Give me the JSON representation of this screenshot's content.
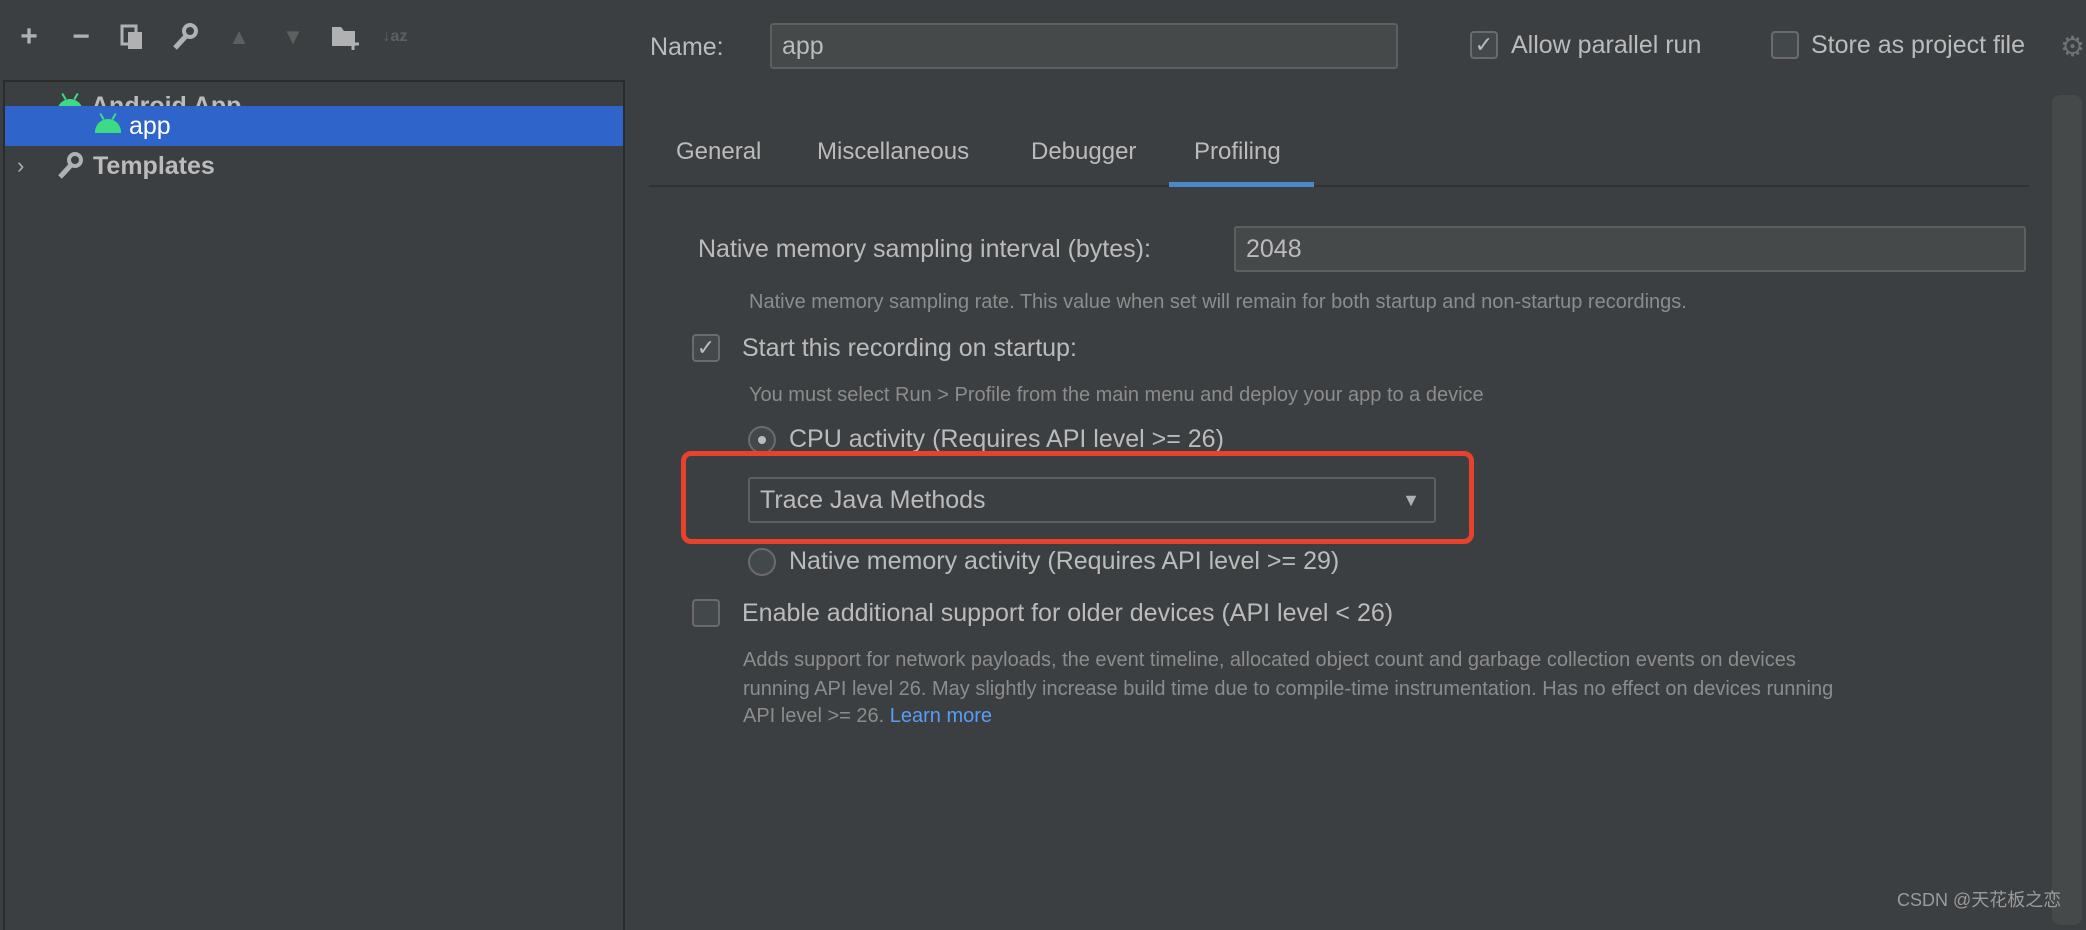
{
  "toolbar": {
    "icons": [
      "add-icon",
      "remove-icon",
      "copy-icon",
      "wrench-icon",
      "move-up-icon",
      "move-down-icon",
      "new-folder-icon",
      "sort-az-icon"
    ]
  },
  "tree": {
    "group": "Android App",
    "item": "app",
    "templates": "Templates"
  },
  "header": {
    "name_label": "Name:",
    "name_value": "app",
    "allow_parallel": "Allow parallel run",
    "allow_parallel_checked": true,
    "store_project": "Store as project file",
    "store_project_checked": false
  },
  "tabs": [
    {
      "label": "General"
    },
    {
      "label": "Miscellaneous"
    },
    {
      "label": "Debugger"
    },
    {
      "label": "Profiling",
      "active": true
    }
  ],
  "profiling": {
    "native_interval_label": "Native memory sampling interval (bytes):",
    "native_interval_value": "2048",
    "native_interval_help": "Native memory sampling rate. This value when set will remain for both startup and non-startup recordings.",
    "startup_label": "Start this recording on startup:",
    "startup_checked": true,
    "startup_help": "You must select Run > Profile from the main menu and deploy your app to a device",
    "cpu_radio": "CPU activity (Requires API level >= 26)",
    "cpu_selected": true,
    "trace_select": "Trace Java Methods",
    "native_radio": "Native memory activity (Requires API level >= 29)",
    "older_label": "Enable additional support for older devices (API level < 26)",
    "older_checked": false,
    "older_help_1": "Adds support for network payloads, the event timeline, allocated object count and garbage collection events on devices",
    "older_help_2": "running API level 26. May slightly increase build time due to compile-time instrumentation. Has no effect on devices running",
    "older_help_3": "API level >= 26.",
    "learn_more": "Learn more"
  },
  "colors": {
    "selection": "#2f65ca",
    "accent": "#4a88c7",
    "highlight_box": "#e8412c",
    "link": "#589df6"
  },
  "watermark": "CSDN @天花板之恋"
}
